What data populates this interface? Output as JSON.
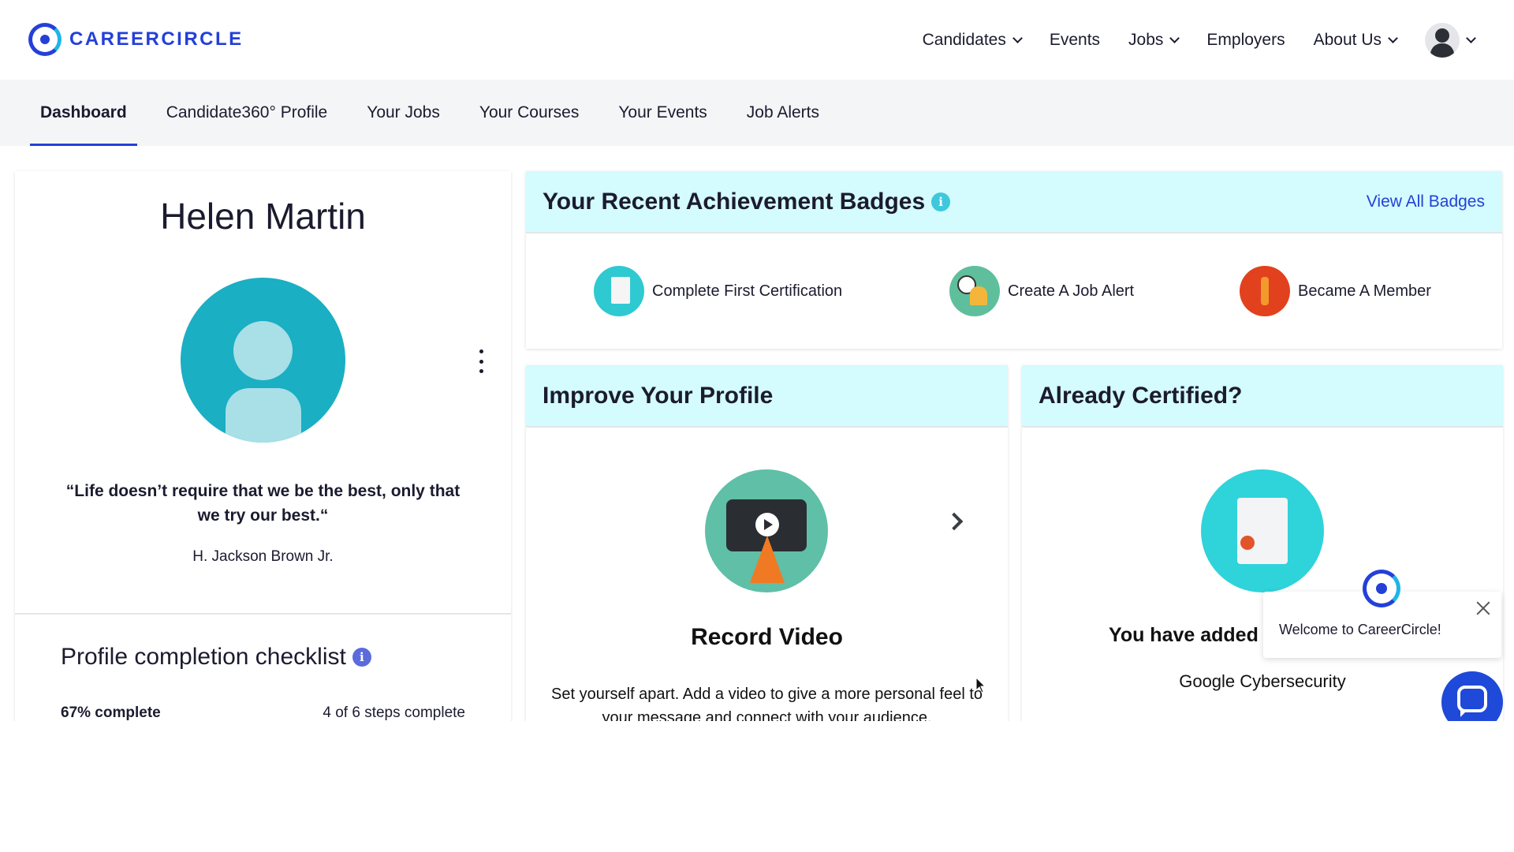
{
  "header": {
    "brand": "CAREERCIRCLE",
    "nav": [
      {
        "label": "Candidates",
        "dropdown": true
      },
      {
        "label": "Events",
        "dropdown": false
      },
      {
        "label": "Jobs",
        "dropdown": true
      },
      {
        "label": "Employers",
        "dropdown": false
      },
      {
        "label": "About Us",
        "dropdown": true
      }
    ]
  },
  "subnav": {
    "tabs": [
      "Dashboard",
      "Candidate360° Profile",
      "Your Jobs",
      "Your Courses",
      "Your Events",
      "Job Alerts"
    ],
    "active": "Dashboard"
  },
  "profile": {
    "name": "Helen Martin",
    "quote": "“Life doesn’t require that we be the best, only that we try our best.“",
    "author": "H. Jackson Brown Jr.",
    "checklist_title": "Profile completion checklist",
    "progress_text": "67% complete",
    "steps_text": "4 of 6 steps complete",
    "progress_percent": 67
  },
  "badges": {
    "title": "Your Recent Achievement Badges",
    "view_all": "View All Badges",
    "items": [
      {
        "label": "Complete First Certification",
        "icon": "certificate-icon"
      },
      {
        "label": "Create A Job Alert",
        "icon": "job-alert-bell-icon"
      },
      {
        "label": "Became A Member",
        "icon": "trophy-icon"
      }
    ]
  },
  "improve": {
    "title": "Improve Your Profile",
    "item_title": "Record Video",
    "item_desc": "Set yourself apart. Add a video to give a more personal feel to your message and connect with your audience."
  },
  "certified": {
    "title": "Already Certified?",
    "text": "You have added",
    "sub": "Google Cybersecurity"
  },
  "chat": {
    "message": "Welcome to CareerCircle!"
  },
  "colors": {
    "brand": "#2440d8",
    "accent_header_bg": "#d4fbfd",
    "avatar_teal": "#1aafc3"
  }
}
